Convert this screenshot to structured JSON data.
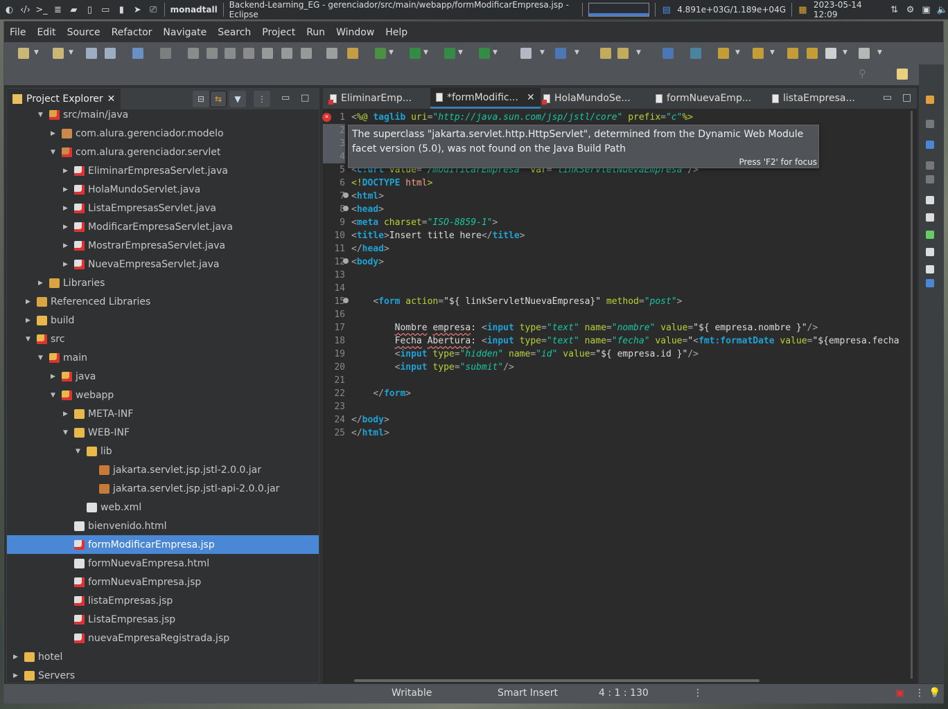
{
  "topbar": {
    "user": "monadtall",
    "window_title": "Backend-Learning_EG - gerenciador/src/main/webapp/formModificarEmpresa.jsp - Eclipse",
    "network": "4.891e+03G/1.189e+04G",
    "datetime": "2023-05-14 12:09"
  },
  "menu": [
    "File",
    "Edit",
    "Source",
    "Refactor",
    "Navigate",
    "Search",
    "Project",
    "Run",
    "Window",
    "Help"
  ],
  "project_explorer": {
    "title": "Project Explorer",
    "items": [
      {
        "label": "src/main/java",
        "level": 2,
        "expanded": true,
        "icon": "source-folder-error-icon",
        "color": "#d9a441"
      },
      {
        "label": "com.alura.gerenciador.modelo",
        "level": 3,
        "expanded": false,
        "icon": "package-icon",
        "color": "#c98a4a"
      },
      {
        "label": "com.alura.gerenciador.servlet",
        "level": 3,
        "expanded": true,
        "icon": "package-error-icon",
        "color": "#c98a4a"
      },
      {
        "label": "EliminarEmpresaServlet.java",
        "level": 4,
        "expanded": false,
        "icon": "java-file-error-icon",
        "color": "#e0e0e0"
      },
      {
        "label": "HolaMundoServlet.java",
        "level": 4,
        "expanded": false,
        "icon": "java-file-error-icon",
        "color": "#e0e0e0"
      },
      {
        "label": "ListaEmpresasServlet.java",
        "level": 4,
        "expanded": false,
        "icon": "java-file-error-icon",
        "color": "#e0e0e0"
      },
      {
        "label": "ModificarEmpresaServlet.java",
        "level": 4,
        "expanded": false,
        "icon": "java-file-error-icon",
        "color": "#e0e0e0"
      },
      {
        "label": "MostrarEmpresaServlet.java",
        "level": 4,
        "expanded": false,
        "icon": "java-file-error-icon",
        "color": "#e0e0e0"
      },
      {
        "label": "NuevaEmpresaServlet.java",
        "level": 4,
        "expanded": false,
        "icon": "java-file-error-icon",
        "color": "#e0e0e0"
      },
      {
        "label": "Libraries",
        "level": 2,
        "expanded": false,
        "icon": "library-icon",
        "color": "#d9a441"
      },
      {
        "label": "Referenced Libraries",
        "level": 1,
        "expanded": false,
        "icon": "library-icon",
        "color": "#d9a441"
      },
      {
        "label": "build",
        "level": 1,
        "expanded": false,
        "icon": "folder-icon",
        "color": "#e8b84a"
      },
      {
        "label": "src",
        "level": 1,
        "expanded": true,
        "icon": "folder-error-icon",
        "color": "#e8b84a"
      },
      {
        "label": "main",
        "level": 2,
        "expanded": true,
        "icon": "folder-error-icon",
        "color": "#e8b84a"
      },
      {
        "label": "java",
        "level": 3,
        "expanded": false,
        "icon": "folder-error-icon",
        "color": "#e8b84a"
      },
      {
        "label": "webapp",
        "level": 3,
        "expanded": true,
        "icon": "folder-error-icon",
        "color": "#e8b84a"
      },
      {
        "label": "META-INF",
        "level": 4,
        "expanded": false,
        "icon": "folder-icon",
        "color": "#e8b84a"
      },
      {
        "label": "WEB-INF",
        "level": 4,
        "expanded": true,
        "icon": "folder-icon",
        "color": "#e8b84a"
      },
      {
        "label": "lib",
        "level": 5,
        "expanded": true,
        "icon": "folder-icon",
        "color": "#e8b84a"
      },
      {
        "label": "jakarta.servlet.jsp.jstl-2.0.0.jar",
        "level": 6,
        "expanded": null,
        "icon": "jar-icon",
        "color": "#c77a3a"
      },
      {
        "label": "jakarta.servlet.jsp.jstl-api-2.0.0.jar",
        "level": 6,
        "expanded": null,
        "icon": "jar-icon",
        "color": "#c77a3a"
      },
      {
        "label": "web.xml",
        "level": 5,
        "expanded": null,
        "icon": "xml-file-icon",
        "color": "#e0e0e0"
      },
      {
        "label": "bienvenido.html",
        "level": 4,
        "expanded": null,
        "icon": "html-file-icon",
        "color": "#e0e0e0"
      },
      {
        "label": "formModificarEmpresa.jsp",
        "level": 4,
        "expanded": null,
        "icon": "jsp-file-error-icon",
        "color": "#e0e0e0",
        "selected": true
      },
      {
        "label": "formNuevaEmpresa.html",
        "level": 4,
        "expanded": null,
        "icon": "html-file-icon",
        "color": "#e0e0e0"
      },
      {
        "label": "formNuevaEmpresa.jsp",
        "level": 4,
        "expanded": null,
        "icon": "jsp-file-error-icon",
        "color": "#e0e0e0"
      },
      {
        "label": "listaEmpresas.jsp",
        "level": 4,
        "expanded": null,
        "icon": "jsp-file-error-icon",
        "color": "#e0e0e0"
      },
      {
        "label": "ListaEmpresas.jsp",
        "level": 4,
        "expanded": null,
        "icon": "jsp-file-error-icon",
        "color": "#e0e0e0"
      },
      {
        "label": "nuevaEmpresaRegistrada.jsp",
        "level": 4,
        "expanded": null,
        "icon": "jsp-file-error-icon",
        "color": "#e0e0e0"
      },
      {
        "label": "hotel",
        "level": 0,
        "expanded": false,
        "icon": "project-icon",
        "color": "#e8b84a"
      },
      {
        "label": "Servers",
        "level": 0,
        "expanded": false,
        "icon": "folder-icon",
        "color": "#e8b84a"
      }
    ]
  },
  "editor": {
    "tabs": [
      {
        "label": "EliminarEmp...",
        "active": false,
        "error": true
      },
      {
        "label": "*formModific...",
        "active": true,
        "error": false
      },
      {
        "label": "HolaMundoSe...",
        "active": false,
        "error": true
      },
      {
        "label": "formNuevaEmp...",
        "active": false,
        "error": false
      },
      {
        "label": "listaEmpresa...",
        "active": false,
        "error": false
      }
    ],
    "lines": [
      "<span class='pu'>&lt;</span><span class='at'>%@</span> <span class='tg'>taglib</span> <span class='at'>uri</span><span class='pu'>=</span><span class='vl'>\"http://java.sun.com/jsp/jstl/core\"</span> <span class='at'>prefix</span><span class='pu'>=</span><span class='vl'>\"c\"</span><span class='at'>%&gt;</span>",
      "",
      "",
      "",
      "<span class='pu'>&lt;</span><span class='tg'>c:url</span> <span class='at'>value</span><span class='pu'>=</span><span class='vl'>\"/modificarEmpresa\"</span> <span class='at'>var</span><span class='pu'>=</span><span class='vl'>\"linkServletNuevaEmpresa\"</span><span class='pu'>/&gt;</span>",
      "<span class='at'>&lt;!</span><span class='tg'>DOCTYPE</span> <span class='dt'>html</span><span class='at'>&gt;</span>",
      "<span class='pu'>&lt;</span><span class='tg'>html</span><span class='pu'>&gt;</span>",
      "<span class='pu'>&lt;</span><span class='tg'>head</span><span class='pu'>&gt;</span>",
      "<span class='pu'>&lt;</span><span class='tg'>meta</span> <span class='at'>charset</span><span class='pu'>=</span><span class='vl'>\"ISO-8859-1\"</span><span class='pu'>&gt;</span>",
      "<span class='pu'>&lt;</span><span class='tg'>title</span><span class='pu'>&gt;</span>Insert title here<span class='pu'>&lt;/</span><span class='tg'>title</span><span class='pu'>&gt;</span>",
      "<span class='pu'>&lt;/</span><span class='tg'>head</span><span class='pu'>&gt;</span>",
      "<span class='pu'>&lt;</span><span class='tg'>body</span><span class='pu'>&gt;</span>",
      "",
      "",
      "    <span class='pu'>&lt;</span><span class='tg'>form</span> <span class='at'>action</span><span class='pu'>=</span>\"${ linkServletNuevaEmpresa}\" <span class='at'>method</span><span class='pu'>=</span><span class='vl'>\"post\"</span><span class='pu'>&gt;</span>",
      "",
      "        <span class='sq'>Nombre</span> <span class='sq'>empresa</span>: <span class='pu'>&lt;</span><span class='tg'>input</span> <span class='at'>type</span><span class='pu'>=</span><span class='vl'>\"text\"</span> <span class='at'>name</span><span class='pu'>=</span><span class='vl'>\"nombre\"</span> <span class='at'>value</span><span class='pu'>=</span>\"${ empresa.nombre }\"<span class='pu'>/&gt;</span>",
      "        <span class='sq'>Fecha</span> <span class='sq'>Abertura</span>: <span class='pu'>&lt;</span><span class='tg'>input</span> <span class='at'>type</span><span class='pu'>=</span><span class='vl'>\"text\"</span> <span class='at'>name</span><span class='pu'>=</span><span class='vl'>\"fecha\"</span> <span class='at'>value</span><span class='pu'>=</span>\"<span class='pu'>&lt;</span><span class='tg'>fmt:formatDate</span> <span class='at'>value</span><span class='pu'>=</span>\"${empresa.fecha",
      "        <span class='pu'>&lt;</span><span class='tg'>input</span> <span class='at'>type</span><span class='pu'>=</span><span class='vl'>\"hidden\"</span> <span class='at'>name</span><span class='pu'>=</span><span class='vl'>\"id\"</span> <span class='at'>value</span><span class='pu'>=</span>\"${ empresa.id }\"<span class='pu'>/&gt;</span>",
      "        <span class='pu'>&lt;</span><span class='tg'>input</span> <span class='at'>type</span><span class='pu'>=</span><span class='vl'>\"submit\"</span><span class='pu'>/&gt;</span>",
      "",
      "    <span class='pu'>&lt;/</span><span class='tg'>form</span><span class='pu'>&gt;</span>",
      "",
      "<span class='pu'>&lt;/</span><span class='tg'>body</span><span class='pu'>&gt;</span>",
      "<span class='pu'>&lt;/</span><span class='tg'>html</span><span class='pu'>&gt;</span>"
    ],
    "tooltip": {
      "message": "The superclass \"jakarta.servlet.http.HttpServlet\", determined from the Dynamic Web Module facet version (5.0), was not found on the Java Build Path",
      "focus_hint": "Press 'F2' for focus"
    }
  },
  "status": {
    "mode": "Writable",
    "insert": "Smart Insert",
    "position": "4 : 1 : 130"
  },
  "colors": {
    "selection": "#4a88d6",
    "tag": "#1ea2d6",
    "attribute": "#b8d433",
    "value": "#17c6a3",
    "error": "#d33333"
  }
}
